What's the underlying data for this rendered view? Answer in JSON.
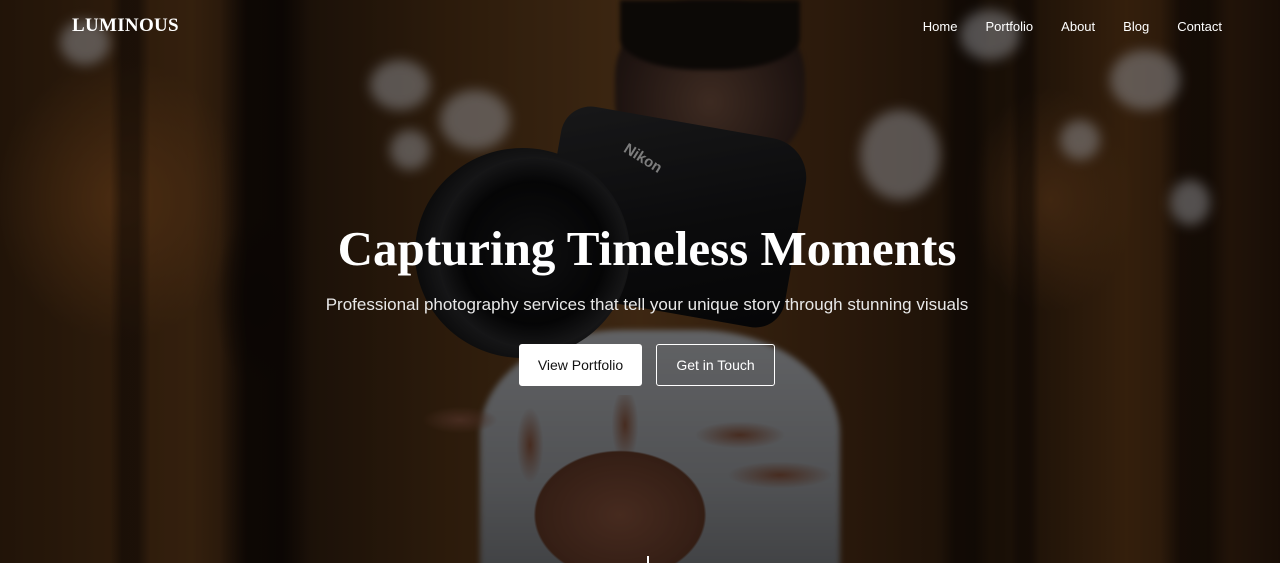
{
  "brand": {
    "logo_text": "LUMINOUS"
  },
  "nav": {
    "items": [
      {
        "label": "Home"
      },
      {
        "label": "Portfolio"
      },
      {
        "label": "About"
      },
      {
        "label": "Blog"
      },
      {
        "label": "Contact"
      }
    ]
  },
  "hero": {
    "title": "Capturing Timeless Moments",
    "subtitle": "Professional photography services that tell your unique story through stunning visuals",
    "primary_button": "View Portfolio",
    "secondary_button": "Get in Touch",
    "background_image": {
      "camera_brand": "Nikon"
    }
  },
  "colors": {
    "text": "#ffffff",
    "primary_button_bg": "#ffffff",
    "primary_button_text": "#111111",
    "overlay": "rgba(0,0,0,0.42)"
  }
}
